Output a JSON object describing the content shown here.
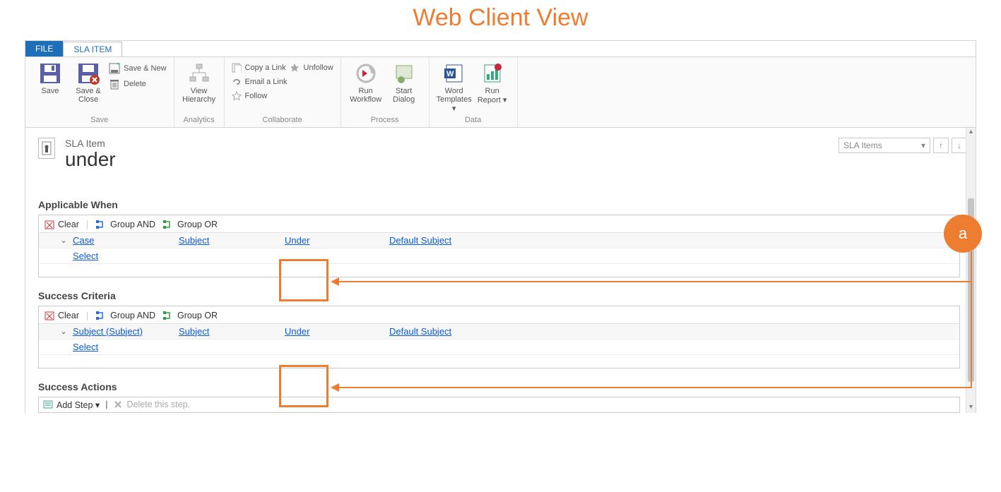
{
  "page_title": "Web Client View",
  "tabs": {
    "file": "FILE",
    "sla_item": "SLA ITEM"
  },
  "ribbon": {
    "save_group": {
      "label": "Save",
      "save": "Save",
      "save_close": "Save &\nClose",
      "save_new": "Save & New",
      "delete": "Delete"
    },
    "analytics_group": {
      "label": "Analytics",
      "view_hierarchy": "View\nHierarchy"
    },
    "collab_group": {
      "label": "Collaborate",
      "copy_link": "Copy a Link",
      "email_link": "Email a Link",
      "follow": "Follow",
      "unfollow": "Unfollow"
    },
    "process_group": {
      "label": "Process",
      "run_workflow": "Run\nWorkflow",
      "start_dialog": "Start\nDialog"
    },
    "data_group": {
      "label": "Data",
      "word_templates": "Word\nTemplates",
      "run_report": "Run\nReport"
    }
  },
  "header": {
    "entity_type": "SLA Item",
    "record_name": "under",
    "view_selector": "SLA Items"
  },
  "sections": {
    "applicable_when": {
      "title": "Applicable When",
      "toolbar": {
        "clear": "Clear",
        "group_and": "Group AND",
        "group_or": "Group OR"
      },
      "row": {
        "entity": "Case",
        "field": "Subject",
        "operator": "Under",
        "value": "Default Subject"
      },
      "select": "Select"
    },
    "success_criteria": {
      "title": "Success Criteria",
      "toolbar": {
        "clear": "Clear",
        "group_and": "Group AND",
        "group_or": "Group OR"
      },
      "row": {
        "entity": "Subject (Subject)",
        "field": "Subject",
        "operator": "Under",
        "value": "Default Subject"
      },
      "select": "Select"
    },
    "success_actions": {
      "title": "Success Actions",
      "bar": {
        "add_step": "Add Step",
        "delete_step": "Delete this step."
      }
    }
  },
  "annotation": {
    "label": "a"
  }
}
